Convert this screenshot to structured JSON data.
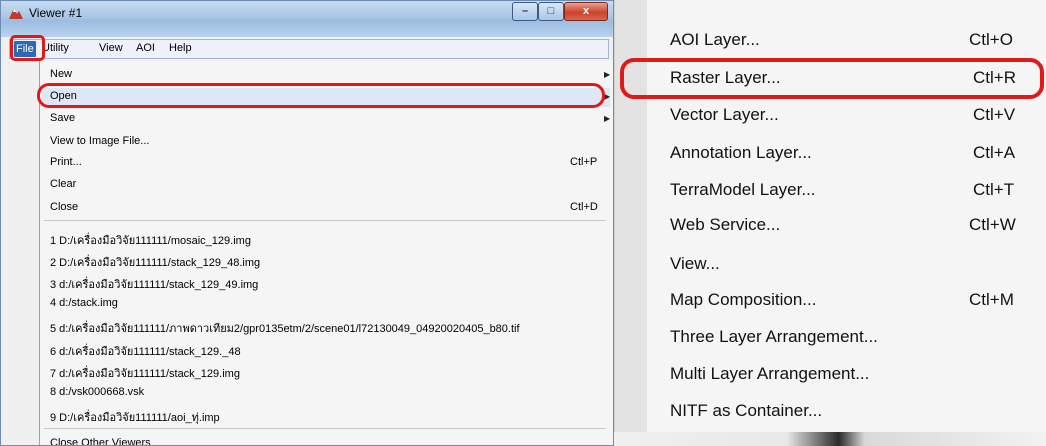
{
  "window": {
    "title": "Viewer #1",
    "controls": {
      "minimize": "–",
      "maximize": "□",
      "close": "x"
    }
  },
  "menubar": {
    "file": "File",
    "utility": "Utility",
    "view": "View",
    "aoi": "AOI",
    "help": "Help"
  },
  "file_menu": {
    "new": "New",
    "open": "Open",
    "save": "Save",
    "view_to_image": "View to Image File...",
    "print": "Print...",
    "print_shortcut": "Ctl+P",
    "clear": "Clear",
    "close": "Close",
    "close_shortcut": "Ctl+D",
    "recent": [
      "1 D:/เครื่องมือวิจัย111111/mosaic_129.img",
      "2 D:/เครื่องมือวิจัย111111/stack_129_48.img",
      "3 d:/เครื่องมือวิจัย111111/stack_129_49.img",
      "4 d:/stack.img",
      "5 d:/เครื่องมือวิจัย111111/ภาพดาวเทียม2/gpr0135etm/2/scene01/l72130049_04920020405_b80.tif",
      "6 d:/เครื่องมือวิจัย111111/stack_129._48",
      "7 d:/เครื่องมือวิจัย111111/stack_129.img",
      "8 d:/vsk000668.vsk",
      "9 D:/เครื่องมือวิจัย111111/aoi_ทุ่.imp"
    ],
    "close_other": "Close Other Viewers"
  },
  "open_submenu": {
    "items": [
      {
        "label": "AOI Layer...",
        "shortcut": "Ctl+O"
      },
      {
        "label": "Raster Layer...",
        "shortcut": "Ctl+R"
      },
      {
        "label": "Vector Layer...",
        "shortcut": "Ctl+V"
      },
      {
        "label": "Annotation Layer...",
        "shortcut": "Ctl+A"
      },
      {
        "label": "TerraModel Layer...",
        "shortcut": "Ctl+T"
      },
      {
        "label": "Web Service...",
        "shortcut": "Ctl+W"
      },
      {
        "label": "View...",
        "shortcut": ""
      },
      {
        "label": "Map Composition...",
        "shortcut": "Ctl+M"
      },
      {
        "label": "Three Layer Arrangement...",
        "shortcut": ""
      },
      {
        "label": "Multi Layer Arrangement...",
        "shortcut": ""
      },
      {
        "label": "NITF as Container...",
        "shortcut": ""
      }
    ]
  },
  "colors": {
    "annotation": "#e01919",
    "menu_highlight": "#2d67b8"
  }
}
